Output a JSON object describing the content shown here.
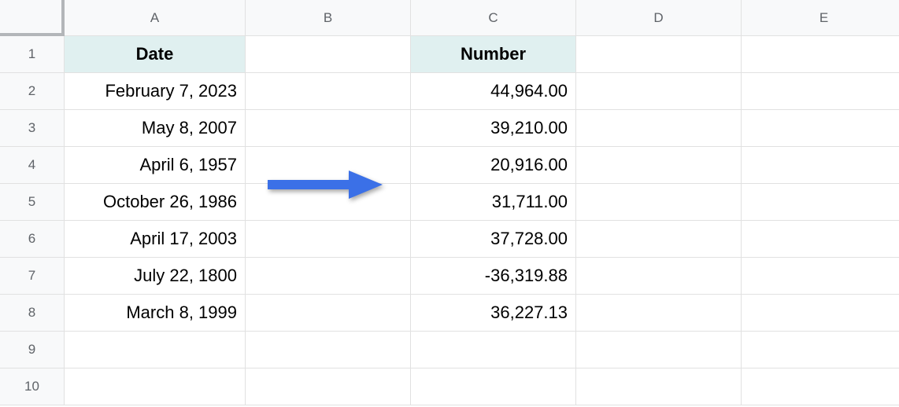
{
  "columns": [
    "A",
    "B",
    "C",
    "D",
    "E"
  ],
  "row_numbers": [
    "1",
    "2",
    "3",
    "4",
    "5",
    "6",
    "7",
    "8",
    "9",
    "10"
  ],
  "headers": {
    "A1": "Date",
    "C1": "Number"
  },
  "data": {
    "A2": "February 7, 2023",
    "A3": "May 8, 2007",
    "A4": "April 6, 1957",
    "A5": "October 26, 1986",
    "A6": "April 17, 2003",
    "A7": "July 22, 1800",
    "A8": "March 8, 1999",
    "C2": "44,964.00",
    "C3": "39,210.00",
    "C4": "20,916.00",
    "C5": "31,711.00",
    "C6": "37,728.00",
    "C7": "-36,319.88",
    "C8": "36,227.13"
  },
  "arrow_color": "#3b70e7"
}
